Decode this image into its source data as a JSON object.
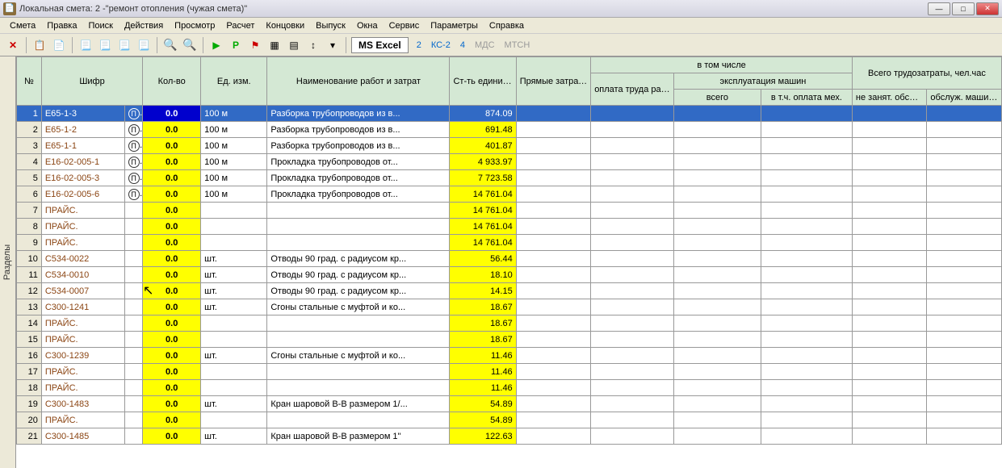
{
  "title": "Локальная смета: 2 -\"ремонт отопления (чужая смета)\"",
  "menu": [
    "Смета",
    "Правка",
    "Поиск",
    "Действия",
    "Просмотр",
    "Расчет",
    "Концовки",
    "Выпуск",
    "Окна",
    "Сервис",
    "Параметры",
    "Справка"
  ],
  "toolbar": {
    "excel": "MS Excel",
    "links": [
      {
        "label": "2",
        "disabled": false
      },
      {
        "label": "КС-2",
        "disabled": false
      },
      {
        "label": "4",
        "disabled": false
      },
      {
        "label": "МДС",
        "disabled": true
      },
      {
        "label": "МТСН",
        "disabled": true
      }
    ]
  },
  "sidetab": "Разделы",
  "headers": {
    "num": "№",
    "shifr": "Шифр",
    "qty": "Кол-во",
    "unit": "Ед. изм.",
    "name": "Наименование работ и затрат",
    "cost": "Ст-ть единицы",
    "direct": "Прямые затраты, руб.",
    "incl": "в том числе",
    "labor": "оплата труда рабочих",
    "machines": "эксплуатация машин",
    "vsego": "всего",
    "mech": "в т.ч. оплата мех.",
    "total_labor": "Всего трудозатраты, чел.час",
    "nz": "не занят. обсл. машин",
    "obs": "обслуж. машины"
  },
  "rows": [
    {
      "n": 1,
      "shifr": "E65-1-3",
      "pi": true,
      "qty": "0.0",
      "unit": "100 м",
      "name": "Разборка трубопроводов из в...",
      "cost": "874.09",
      "sel": true
    },
    {
      "n": 2,
      "shifr": "E65-1-2",
      "pi": true,
      "qty": "0.0",
      "unit": "100 м",
      "name": "Разборка трубопроводов из в...",
      "cost": "691.48"
    },
    {
      "n": 3,
      "shifr": "E65-1-1",
      "pi": true,
      "qty": "0.0",
      "unit": "100 м",
      "name": "Разборка трубопроводов из в...",
      "cost": "401.87"
    },
    {
      "n": 4,
      "shifr": "E16-02-005-1",
      "pi": true,
      "qty": "0.0",
      "unit": "100 м",
      "name": "Прокладка трубопроводов от...",
      "cost": "4 933.97"
    },
    {
      "n": 5,
      "shifr": "E16-02-005-3",
      "pi": true,
      "qty": "0.0",
      "unit": "100 м",
      "name": "Прокладка трубопроводов от...",
      "cost": "7 723.58"
    },
    {
      "n": 6,
      "shifr": "E16-02-005-6",
      "pi": true,
      "qty": "0.0",
      "unit": "100 м",
      "name": "Прокладка трубопроводов от...",
      "cost": "14 761.04"
    },
    {
      "n": 7,
      "shifr": "ПРАЙС.",
      "pi": false,
      "qty": "0.0",
      "unit": "",
      "name": "",
      "cost": "14 761.04"
    },
    {
      "n": 8,
      "shifr": "ПРАЙС.",
      "pi": false,
      "qty": "0.0",
      "unit": "",
      "name": "",
      "cost": "14 761.04"
    },
    {
      "n": 9,
      "shifr": "ПРАЙС.",
      "pi": false,
      "qty": "0.0",
      "unit": "",
      "name": "",
      "cost": "14 761.04"
    },
    {
      "n": 10,
      "shifr": "C534-0022",
      "pi": false,
      "qty": "0.0",
      "unit": "шт.",
      "name": "Отводы 90 град. с радиусом кр...",
      "cost": "56.44"
    },
    {
      "n": 11,
      "shifr": "C534-0010",
      "pi": false,
      "qty": "0.0",
      "unit": "шт.",
      "name": "Отводы 90 град. с радиусом кр...",
      "cost": "18.10"
    },
    {
      "n": 12,
      "shifr": "C534-0007",
      "pi": false,
      "qty": "0.0",
      "unit": "шт.",
      "name": "Отводы 90 град. с радиусом кр...",
      "cost": "14.15"
    },
    {
      "n": 13,
      "shifr": "C300-1241",
      "pi": false,
      "qty": "0.0",
      "unit": "шт.",
      "name": "Сгоны стальные с муфтой и ко...",
      "cost": "18.67"
    },
    {
      "n": 14,
      "shifr": "ПРАЙС.",
      "pi": false,
      "qty": "0.0",
      "unit": "",
      "name": "",
      "cost": "18.67"
    },
    {
      "n": 15,
      "shifr": "ПРАЙС.",
      "pi": false,
      "qty": "0.0",
      "unit": "",
      "name": "",
      "cost": "18.67"
    },
    {
      "n": 16,
      "shifr": "C300-1239",
      "pi": false,
      "qty": "0.0",
      "unit": "шт.",
      "name": "Сгоны стальные с муфтой и ко...",
      "cost": "11.46"
    },
    {
      "n": 17,
      "shifr": "ПРАЙС.",
      "pi": false,
      "qty": "0.0",
      "unit": "",
      "name": "",
      "cost": "11.46"
    },
    {
      "n": 18,
      "shifr": "ПРАЙС.",
      "pi": false,
      "qty": "0.0",
      "unit": "",
      "name": "",
      "cost": "11.46"
    },
    {
      "n": 19,
      "shifr": "C300-1483",
      "pi": false,
      "qty": "0.0",
      "unit": "шт.",
      "name": "Кран шаровой В-В размером 1/...",
      "cost": "54.89"
    },
    {
      "n": 20,
      "shifr": "ПРАЙС.",
      "pi": false,
      "qty": "0.0",
      "unit": "",
      "name": "",
      "cost": "54.89"
    },
    {
      "n": 21,
      "shifr": "C300-1485",
      "pi": false,
      "qty": "0.0",
      "unit": "шт.",
      "name": "Кран шаровой В-В размером 1\"",
      "cost": "122.63"
    }
  ]
}
